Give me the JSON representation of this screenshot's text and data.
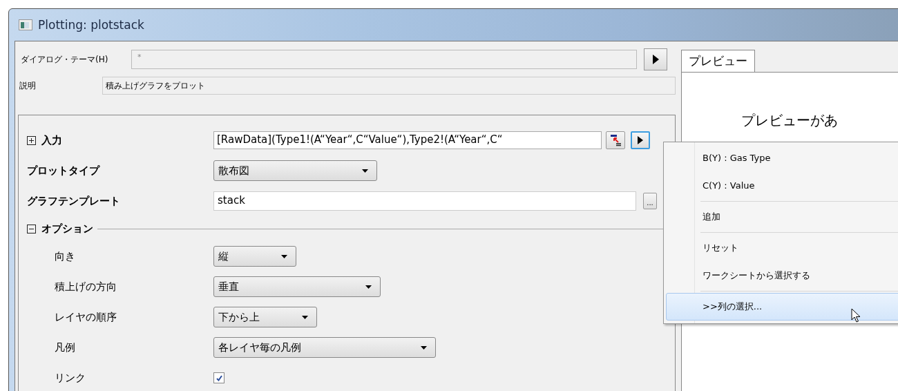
{
  "window": {
    "title": "Plotting: plotstack"
  },
  "dialog_theme": {
    "label": "ダイアログ・テーマ(H)",
    "placeholder": "*"
  },
  "description": {
    "label": "説明",
    "value": "積み上げグラフをプロット"
  },
  "input": {
    "label": "入力",
    "expanded": false,
    "value": "[RawData](Type1!(A“Year“,C“Value“),Type2!(A“Year“,C“"
  },
  "plot_type": {
    "label": "プロットタイプ",
    "value": "散布図"
  },
  "graph_template": {
    "label": "グラフテンプレート",
    "value": "stack",
    "browse": "..."
  },
  "options": {
    "label": "オプション",
    "expanded": true,
    "items": [
      {
        "kind": "dropdown",
        "label": "向き",
        "value": "縦"
      },
      {
        "kind": "dropdown",
        "label": "積上げの方向",
        "value": "垂直"
      },
      {
        "kind": "dropdown",
        "label": "レイヤの順序",
        "value": "下から上"
      },
      {
        "kind": "dropdown",
        "label": "凡例",
        "value": "各レイヤ毎の凡例"
      },
      {
        "kind": "checkbox",
        "label": "リンク",
        "checked": true
      }
    ]
  },
  "preview": {
    "tab": "プレビュー",
    "message": "プレビューがあ"
  },
  "context_menu": {
    "items": [
      {
        "kind": "item",
        "label": "B(Y) : Gas Type",
        "selected": false
      },
      {
        "kind": "item",
        "label": "C(Y) : Value",
        "selected": false
      },
      {
        "kind": "separator"
      },
      {
        "kind": "item",
        "label": "追加",
        "selected": false
      },
      {
        "kind": "separator"
      },
      {
        "kind": "item",
        "label": "リセット",
        "selected": false
      },
      {
        "kind": "item",
        "label": "ワークシートから選択する",
        "selected": false
      },
      {
        "kind": "separator"
      },
      {
        "kind": "item",
        "label": ">>列の選択...",
        "selected": true
      }
    ]
  }
}
